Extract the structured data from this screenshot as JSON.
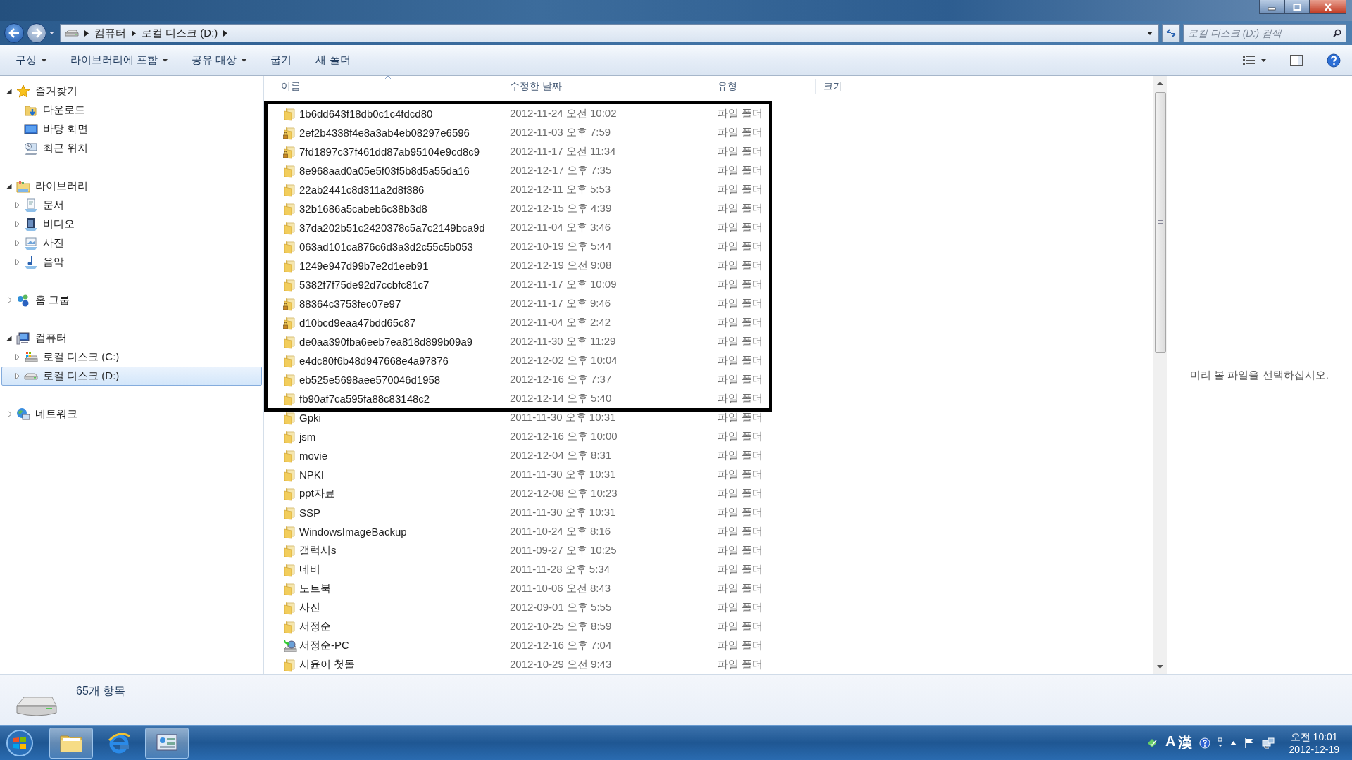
{
  "address": {
    "breadcrumbs": [
      "컴퓨터",
      "로컬 디스크 (D:)"
    ]
  },
  "search": {
    "placeholder": "로컬 디스크 (D:) 검색"
  },
  "toolbar": [
    {
      "label": "구성",
      "dropdown": true
    },
    {
      "label": "라이브러리에 포함",
      "dropdown": true
    },
    {
      "label": "공유 대상",
      "dropdown": true
    },
    {
      "label": "굽기",
      "dropdown": false
    },
    {
      "label": "새 폴더",
      "dropdown": false
    }
  ],
  "sidebar": {
    "items": [
      {
        "label": "즐겨찾기",
        "kind": "star",
        "expanded": true,
        "selected": false,
        "children": [
          {
            "label": "다운로드",
            "kind": "downloads",
            "selected": false
          },
          {
            "label": "바탕 화면",
            "kind": "desktop",
            "selected": false
          },
          {
            "label": "최근 위치",
            "kind": "recent",
            "selected": false
          }
        ]
      },
      {
        "label": "라이브러리",
        "kind": "library",
        "expanded": true,
        "selected": false,
        "children": [
          {
            "label": "문서",
            "kind": "documents",
            "expanded": false,
            "selected": false
          },
          {
            "label": "비디오",
            "kind": "videos",
            "expanded": false,
            "selected": false
          },
          {
            "label": "사진",
            "kind": "pictures",
            "expanded": false,
            "selected": false
          },
          {
            "label": "음악",
            "kind": "music",
            "expanded": false,
            "selected": false
          }
        ]
      },
      {
        "label": "홈 그룹",
        "kind": "homegroup",
        "expanded": false,
        "selected": false
      },
      {
        "label": "컴퓨터",
        "kind": "computer",
        "expanded": true,
        "selected": false,
        "children": [
          {
            "label": "로컬 디스크 (C:)",
            "kind": "system-drive",
            "expanded": false,
            "selected": false
          },
          {
            "label": "로컬 디스크 (D:)",
            "kind": "drive",
            "expanded": false,
            "selected": true
          }
        ]
      },
      {
        "label": "네트워크",
        "kind": "network",
        "expanded": false,
        "selected": false
      }
    ]
  },
  "table": {
    "columns": [
      {
        "label": "이름",
        "sorted": true
      },
      {
        "label": "수정한 날짜",
        "sorted": false
      },
      {
        "label": "유형",
        "sorted": false
      },
      {
        "label": "크기",
        "sorted": false
      }
    ],
    "rows": [
      {
        "name": "1b6dd643f18db0c1c4fdcd80",
        "modified": "2012-11-24 오전 10:02",
        "type": "파일 폴더",
        "kind": "folder",
        "highlighted": true,
        "selected": false
      },
      {
        "name": "2ef2b4338f4e8a3ab4eb08297e6596",
        "modified": "2012-11-03 오후 7:59",
        "type": "파일 폴더",
        "kind": "locked",
        "highlighted": true,
        "selected": false
      },
      {
        "name": "7fd1897c37f461dd87ab95104e9cd8c9",
        "modified": "2012-11-17 오전 11:34",
        "type": "파일 폴더",
        "kind": "locked",
        "highlighted": true,
        "selected": false
      },
      {
        "name": "8e968aad0a05e5f03f5b8d5a55da16",
        "modified": "2012-12-17 오후 7:35",
        "type": "파일 폴더",
        "kind": "folder",
        "highlighted": true,
        "selected": false
      },
      {
        "name": "22ab2441c8d311a2d8f386",
        "modified": "2012-12-11 오후 5:53",
        "type": "파일 폴더",
        "kind": "folder",
        "highlighted": true,
        "selected": false
      },
      {
        "name": "32b1686a5cabeb6c38b3d8",
        "modified": "2012-12-15 오후 4:39",
        "type": "파일 폴더",
        "kind": "folder",
        "highlighted": true,
        "selected": false
      },
      {
        "name": "37da202b51c2420378c5a7c2149bca9d",
        "modified": "2012-11-04 오후 3:46",
        "type": "파일 폴더",
        "kind": "folder",
        "highlighted": true,
        "selected": false
      },
      {
        "name": "063ad101ca876c6d3a3d2c55c5b053",
        "modified": "2012-10-19 오후 5:44",
        "type": "파일 폴더",
        "kind": "folder",
        "highlighted": true,
        "selected": false
      },
      {
        "name": "1249e947d99b7e2d1eeb91",
        "modified": "2012-12-19 오전 9:08",
        "type": "파일 폴더",
        "kind": "folder",
        "highlighted": true,
        "selected": false
      },
      {
        "name": "5382f7f75de92d7ccbfc81c7",
        "modified": "2012-11-17 오후 10:09",
        "type": "파일 폴더",
        "kind": "folder",
        "highlighted": true,
        "selected": false
      },
      {
        "name": "88364c3753fec07e97",
        "modified": "2012-11-17 오후 9:46",
        "type": "파일 폴더",
        "kind": "locked",
        "highlighted": true,
        "selected": false
      },
      {
        "name": "d10bcd9eaa47bdd65c87",
        "modified": "2012-11-04 오후 2:42",
        "type": "파일 폴더",
        "kind": "locked",
        "highlighted": true,
        "selected": false
      },
      {
        "name": "de0aa390fba6eeb7ea818d899b09a9",
        "modified": "2012-11-30 오후 11:29",
        "type": "파일 폴더",
        "kind": "folder",
        "highlighted": true,
        "selected": false
      },
      {
        "name": "e4dc80f6b48d947668e4a97876",
        "modified": "2012-12-02 오후 10:04",
        "type": "파일 폴더",
        "kind": "folder",
        "highlighted": true,
        "selected": false
      },
      {
        "name": "eb525e5698aee570046d1958",
        "modified": "2012-12-16 오후 7:37",
        "type": "파일 폴더",
        "kind": "folder",
        "highlighted": true,
        "selected": false
      },
      {
        "name": "fb90af7ca595fa88c83148c2",
        "modified": "2012-12-14 오후 5:40",
        "type": "파일 폴더",
        "kind": "folder",
        "highlighted": true,
        "selected": false
      },
      {
        "name": "Gpki",
        "modified": "2011-11-30 오후 10:31",
        "type": "파일 폴더",
        "kind": "folder",
        "highlighted": false,
        "selected": false
      },
      {
        "name": "jsm",
        "modified": "2012-12-16 오후 10:00",
        "type": "파일 폴더",
        "kind": "folder",
        "highlighted": false,
        "selected": false
      },
      {
        "name": "movie",
        "modified": "2012-12-04 오후 8:31",
        "type": "파일 폴더",
        "kind": "folder",
        "highlighted": false,
        "selected": false
      },
      {
        "name": "NPKI",
        "modified": "2011-11-30 오후 10:31",
        "type": "파일 폴더",
        "kind": "folder",
        "highlighted": false,
        "selected": false
      },
      {
        "name": "ppt자료",
        "modified": "2012-12-08 오후 10:23",
        "type": "파일 폴더",
        "kind": "folder",
        "highlighted": false,
        "selected": false
      },
      {
        "name": "SSP",
        "modified": "2011-11-30 오후 10:31",
        "type": "파일 폴더",
        "kind": "folder",
        "highlighted": false,
        "selected": false
      },
      {
        "name": "WindowsImageBackup",
        "modified": "2011-10-24 오후 8:16",
        "type": "파일 폴더",
        "kind": "folder",
        "highlighted": false,
        "selected": false
      },
      {
        "name": "갤럭시s",
        "modified": "2011-09-27 오후 10:25",
        "type": "파일 폴더",
        "kind": "folder",
        "highlighted": false,
        "selected": false
      },
      {
        "name": "네비",
        "modified": "2011-11-28 오후 5:34",
        "type": "파일 폴더",
        "kind": "folder",
        "highlighted": false,
        "selected": false
      },
      {
        "name": "노트북",
        "modified": "2011-10-06 오전 8:43",
        "type": "파일 폴더",
        "kind": "folder",
        "highlighted": false,
        "selected": false
      },
      {
        "name": "사진",
        "modified": "2012-09-01 오후 5:55",
        "type": "파일 폴더",
        "kind": "folder",
        "highlighted": false,
        "selected": false
      },
      {
        "name": "서정순",
        "modified": "2012-10-25 오후 8:59",
        "type": "파일 폴더",
        "kind": "folder",
        "highlighted": false,
        "selected": false
      },
      {
        "name": "서정순-PC",
        "modified": "2012-12-16 오후 7:04",
        "type": "파일 폴더",
        "kind": "network",
        "highlighted": false,
        "selected": false
      },
      {
        "name": "시윤이 첫돌",
        "modified": "2012-10-29 오전 9:43",
        "type": "파일 폴더",
        "kind": "folder",
        "highlighted": false,
        "selected": false
      }
    ]
  },
  "preview": {
    "message": "미리 볼 파일을 선택하십시오."
  },
  "status_bar": {
    "count": "65개 항목"
  },
  "taskbar": {
    "buttons": [
      {
        "kind": "explorer",
        "running": true
      },
      {
        "kind": "browser",
        "running": false
      },
      {
        "kind": "app",
        "running": true
      }
    ],
    "ime": [
      "A",
      "漢"
    ],
    "time": "오전 10:01",
    "date": "2012-12-19"
  }
}
